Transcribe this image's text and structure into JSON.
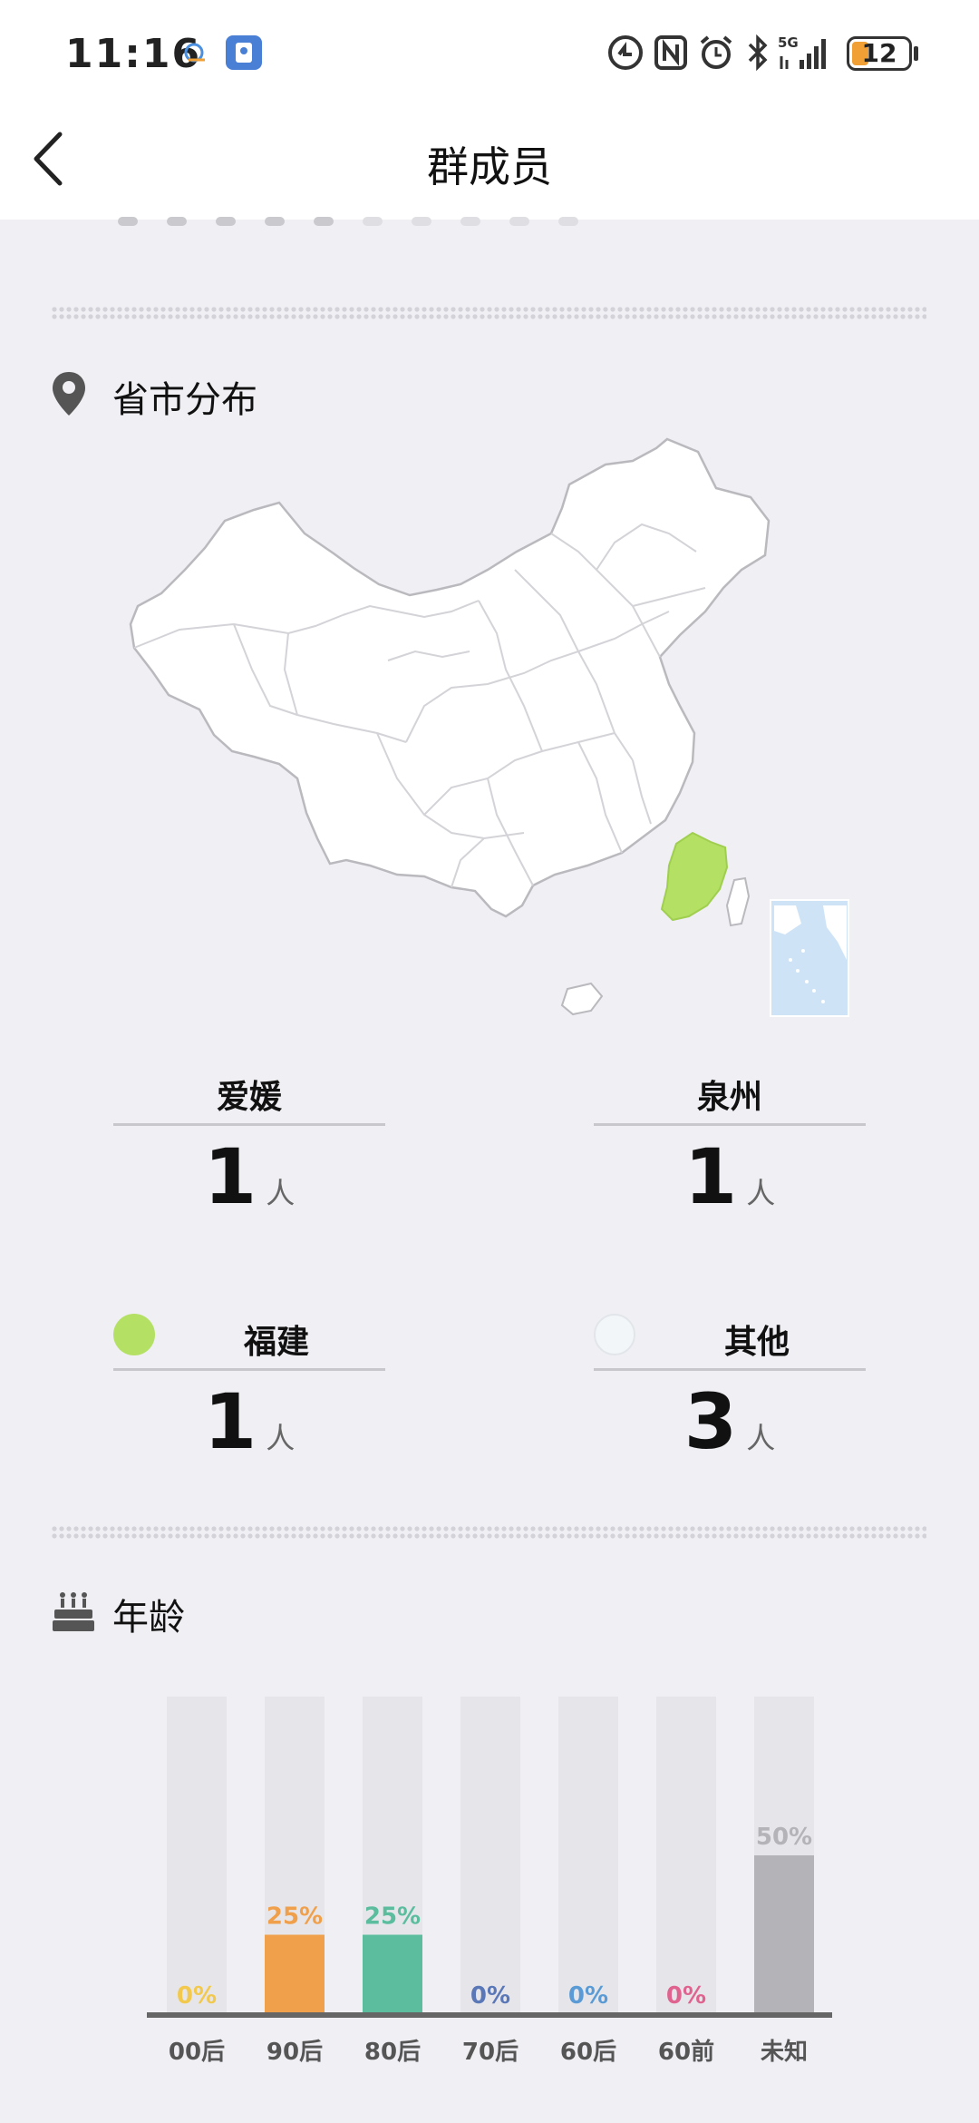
{
  "status_bar": {
    "time": "11:16",
    "battery": "12",
    "network": "5G"
  },
  "nav": {
    "title": "群成员"
  },
  "province": {
    "title": "省市分布",
    "highlight_color": "#b4e164",
    "stats": [
      {
        "label": "爱媛",
        "count": "1",
        "unit": "人"
      },
      {
        "label": "泉州",
        "count": "1",
        "unit": "人"
      },
      {
        "label": "福建",
        "count": "1",
        "unit": "人",
        "color": "#b4e164"
      },
      {
        "label": "其他",
        "count": "3",
        "unit": "人",
        "color": "#f3f6f9"
      }
    ]
  },
  "age": {
    "title": "年龄",
    "chart_data": {
      "type": "bar",
      "categories": [
        "00后",
        "90后",
        "80后",
        "70后",
        "60后",
        "60前",
        "未知"
      ],
      "values": [
        0,
        25,
        25,
        0,
        0,
        0,
        50
      ],
      "labels": [
        "0%",
        "25%",
        "25%",
        "0%",
        "0%",
        "0%",
        "50%"
      ],
      "colors": [
        "#f2c94c",
        "#f0a04b",
        "#5bbd9e",
        "#5a77b8",
        "#5a9bd6",
        "#e0638f",
        "#b4b4b8"
      ],
      "ylim": [
        0,
        100
      ],
      "grid": false
    }
  }
}
